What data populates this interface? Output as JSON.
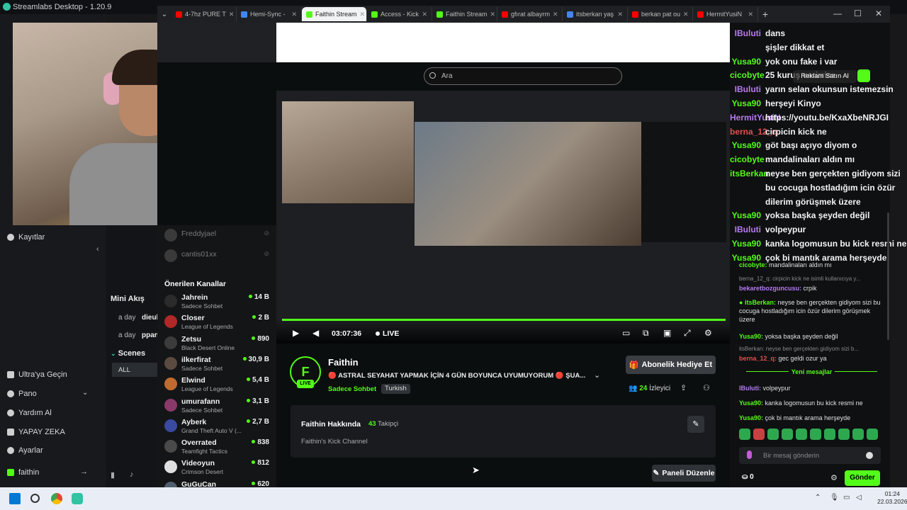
{
  "streamlabs": {
    "title": "Streamlabs Desktop - 1.20.9",
    "nav": {
      "recordings": "Kayıtlar",
      "ultra": "Ultra'ya Geçin",
      "pano": "Pano",
      "help": "Yardım Al",
      "ai": "YAPAY ZEKA",
      "settings": "Ayarlar",
      "account": "faithin"
    },
    "mini_feed": {
      "title": "Mini Akış",
      "rows": [
        "a day",
        "a day"
      ],
      "names": [
        "dieul",
        "ppan"
      ]
    },
    "scenes": {
      "title": "Scenes",
      "filter": "ALL"
    }
  },
  "browser": {
    "tabs": [
      {
        "label": "4-7hz PURE T",
        "color": "#ff0000"
      },
      {
        "label": "Hemi-Sync -",
        "color": "#4285f4"
      },
      {
        "label": "Faithin Stream",
        "color": "#53fc18"
      },
      {
        "label": "Access - Kick",
        "color": "#53fc18"
      },
      {
        "label": "Faithin Stream",
        "color": "#53fc18"
      },
      {
        "label": "gfırat albayrm",
        "color": "#ff0000"
      },
      {
        "label": "itsberkan yaş",
        "color": "#4285f4"
      },
      {
        "label": "berkan pat ou",
        "color": "#ff0000"
      },
      {
        "label": "HermitYusiN",
        "color": "#ff0000"
      }
    ]
  },
  "kick": {
    "search_placeholder": "Ara",
    "offline_channels": [
      {
        "name": "Freddyjael"
      },
      {
        "name": "cantis01xx"
      }
    ],
    "recommended_title": "Önerilen Kanallar",
    "channels": [
      {
        "name": "Jahrein",
        "category": "Sadece Sohbet",
        "viewers": "14 B",
        "color": "#2b2b2b"
      },
      {
        "name": "Closer",
        "category": "League of Legends",
        "viewers": "2 B",
        "color": "#b02828"
      },
      {
        "name": "Zetsu",
        "category": "Black Desert Online",
        "viewers": "890",
        "color": "#3b3b3b"
      },
      {
        "name": "ilkerfirat",
        "category": "Sadece Sohbet",
        "viewers": "30,9 B",
        "color": "#5a4a40"
      },
      {
        "name": "Elwind",
        "category": "League of Legends",
        "viewers": "5,4 B",
        "color": "#c06a30"
      },
      {
        "name": "umurafann",
        "category": "Sadece Sohbet",
        "viewers": "3,1 B",
        "color": "#8a3a6a"
      },
      {
        "name": "Ayberk",
        "category": "Grand Theft Auto V (...",
        "viewers": "2,7 B",
        "color": "#3a4aa0"
      },
      {
        "name": "Overrated",
        "category": "Teamfight Tactics",
        "viewers": "838",
        "color": "#4a4a4a"
      },
      {
        "name": "Videoyun",
        "category": "Crimson Desert",
        "viewers": "812",
        "color": "#e0e0e0"
      },
      {
        "name": "GuGuCan",
        "category": "",
        "viewers": "620",
        "color": "#506070"
      }
    ],
    "player": {
      "time": "03:07:36",
      "live": "LIVE"
    },
    "stream": {
      "channel": "Faithin",
      "title": "🔴 ASTRAL SEYAHAT YAPMAK İÇİN 4 GÜN BOYUNCA UYUMUYORUM 🔴 ŞUA...",
      "category": "Sadece Sohbet",
      "tag": "Turkish",
      "gift_button": "Abonelik Hediye Et",
      "viewers_count": "24",
      "viewers_label": "İzleyici",
      "live_badge": "LIVE",
      "avatar_letter": "F"
    },
    "about": {
      "title": "Faithin Hakkında",
      "followers_count": "43",
      "followers_label": "Takipçi",
      "description": "Faithin's Kick Channel"
    },
    "panel_button": "Paneli Düzenle"
  },
  "chat": {
    "overlay_messages": [
      {
        "user": "IBuluti",
        "text": "dans",
        "color": "#b57af0"
      },
      {
        "user": "",
        "text": "şişler dikkat et",
        "color": ""
      },
      {
        "user": "Yusa90",
        "text": "yok onu fake i var",
        "color": "#53fc18"
      },
      {
        "user": "cicobyte",
        "text": "25 kuruş verirrim",
        "color": "#53fc18"
      },
      {
        "user": "IBuluti",
        "text": "yarın selan okunsun istemezsin",
        "color": "#b57af0"
      },
      {
        "user": "Yusa90",
        "text": "herşeyi Kinyo",
        "color": "#53fc18"
      },
      {
        "user": "HermitYusiN",
        "text": "https://youtu.be/KxaXbeNRJGI",
        "color": "#b57af0"
      },
      {
        "user": "berna_12_q",
        "text": "cirpicin kick ne",
        "color": "#e05050"
      },
      {
        "user": "Yusa90",
        "text": "göt başı açıyo diyom o",
        "color": "#53fc18"
      },
      {
        "user": "cicobyte",
        "text": "mandalinaları aldın mı",
        "color": "#53fc18"
      },
      {
        "user": "itsBerkan",
        "text": "neyse ben gerçekten gidiyom sizi",
        "color": "#53fc18"
      },
      {
        "user": "",
        "text": "bu cocuga hostladığım icin özür",
        "color": ""
      },
      {
        "user": "",
        "text": "dilerim görüşmek üzere",
        "color": ""
      },
      {
        "user": "Yusa90",
        "text": "yoksa başka şeyden değil",
        "color": "#53fc18"
      },
      {
        "user": "IBuluti",
        "text": "volpeypur",
        "color": "#b57af0"
      },
      {
        "user": "Yusa90",
        "text": "kanka logomusun bu kick resmi ne",
        "color": "#53fc18"
      },
      {
        "user": "Yusa90",
        "text": "çok bi mantık arama herşeyde",
        "color": "#53fc18"
      }
    ],
    "small_messages": [
      {
        "user": "cicobyte:",
        "text": "mandalinaları aldın mı",
        "color": "#53fc18"
      },
      {
        "user": "bekaretbozguncusu:",
        "text": "crpik",
        "color": "#b57af0"
      },
      {
        "user": "itsBerkan:",
        "text": "neyse ben gerçekten gidiyom sizi bu cocuga hostladığım icin özür dilerim görüşmek üzere",
        "color": "#53fc18"
      },
      {
        "user": "Yusa90:",
        "text": "yoksa başka şeyden değil",
        "color": "#53fc18"
      },
      {
        "user": "berna_12_q:",
        "text": "gec geldi ozur ya",
        "color": "#e05050"
      }
    ],
    "reply_contexts": [
      "berna_12_q: cirpicin kick ne isimli kullanıcıya y...",
      "itsBerkan: neyse ben gerçekten gidiyom sizi b..."
    ],
    "new_messages_label": "Yeni mesajlar",
    "new_messages": [
      {
        "user": "IBuluti:",
        "text": "volpeypur",
        "color": "#b57af0"
      },
      {
        "user": "Yusa90:",
        "text": "kanka logomusun bu kick resmi ne",
        "color": "#53fc18"
      },
      {
        "user": "Yusa90:",
        "text": "çok bi mantık arama herşeyde",
        "color": "#53fc18"
      }
    ],
    "input_placeholder": "Bir mesaj gönderin",
    "points": "0",
    "send_button": "Gönder",
    "buy_ad": "Reklam Satın Al"
  },
  "taskbar": {
    "time": "01:24",
    "date": "22.03.2026"
  }
}
